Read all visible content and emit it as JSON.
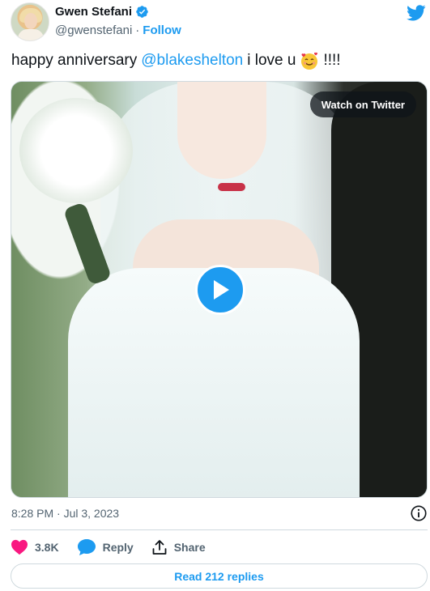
{
  "author": {
    "name": "Gwen Stefani",
    "handle": "@gwenstefani",
    "separator": "·",
    "follow_label": "Follow",
    "verified": true
  },
  "tweet": {
    "text_before": "happy anniversary",
    "mention": "@blakeshelton",
    "text_after": "i love u",
    "emoji": "smiling-face-with-hearts",
    "text_end": "!!!!"
  },
  "media": {
    "watch_label": "Watch on Twitter"
  },
  "meta": {
    "timestamp": "8:28 PM · Jul 3, 2023"
  },
  "actions": {
    "like_count": "3.8K",
    "reply_label": "Reply",
    "share_label": "Share"
  },
  "replies": {
    "label": "Read 212 replies"
  },
  "colors": {
    "accent": "#1d9bf0",
    "like": "#f91880",
    "text": "#0f1419",
    "muted": "#536471",
    "border": "#cfd9de"
  }
}
